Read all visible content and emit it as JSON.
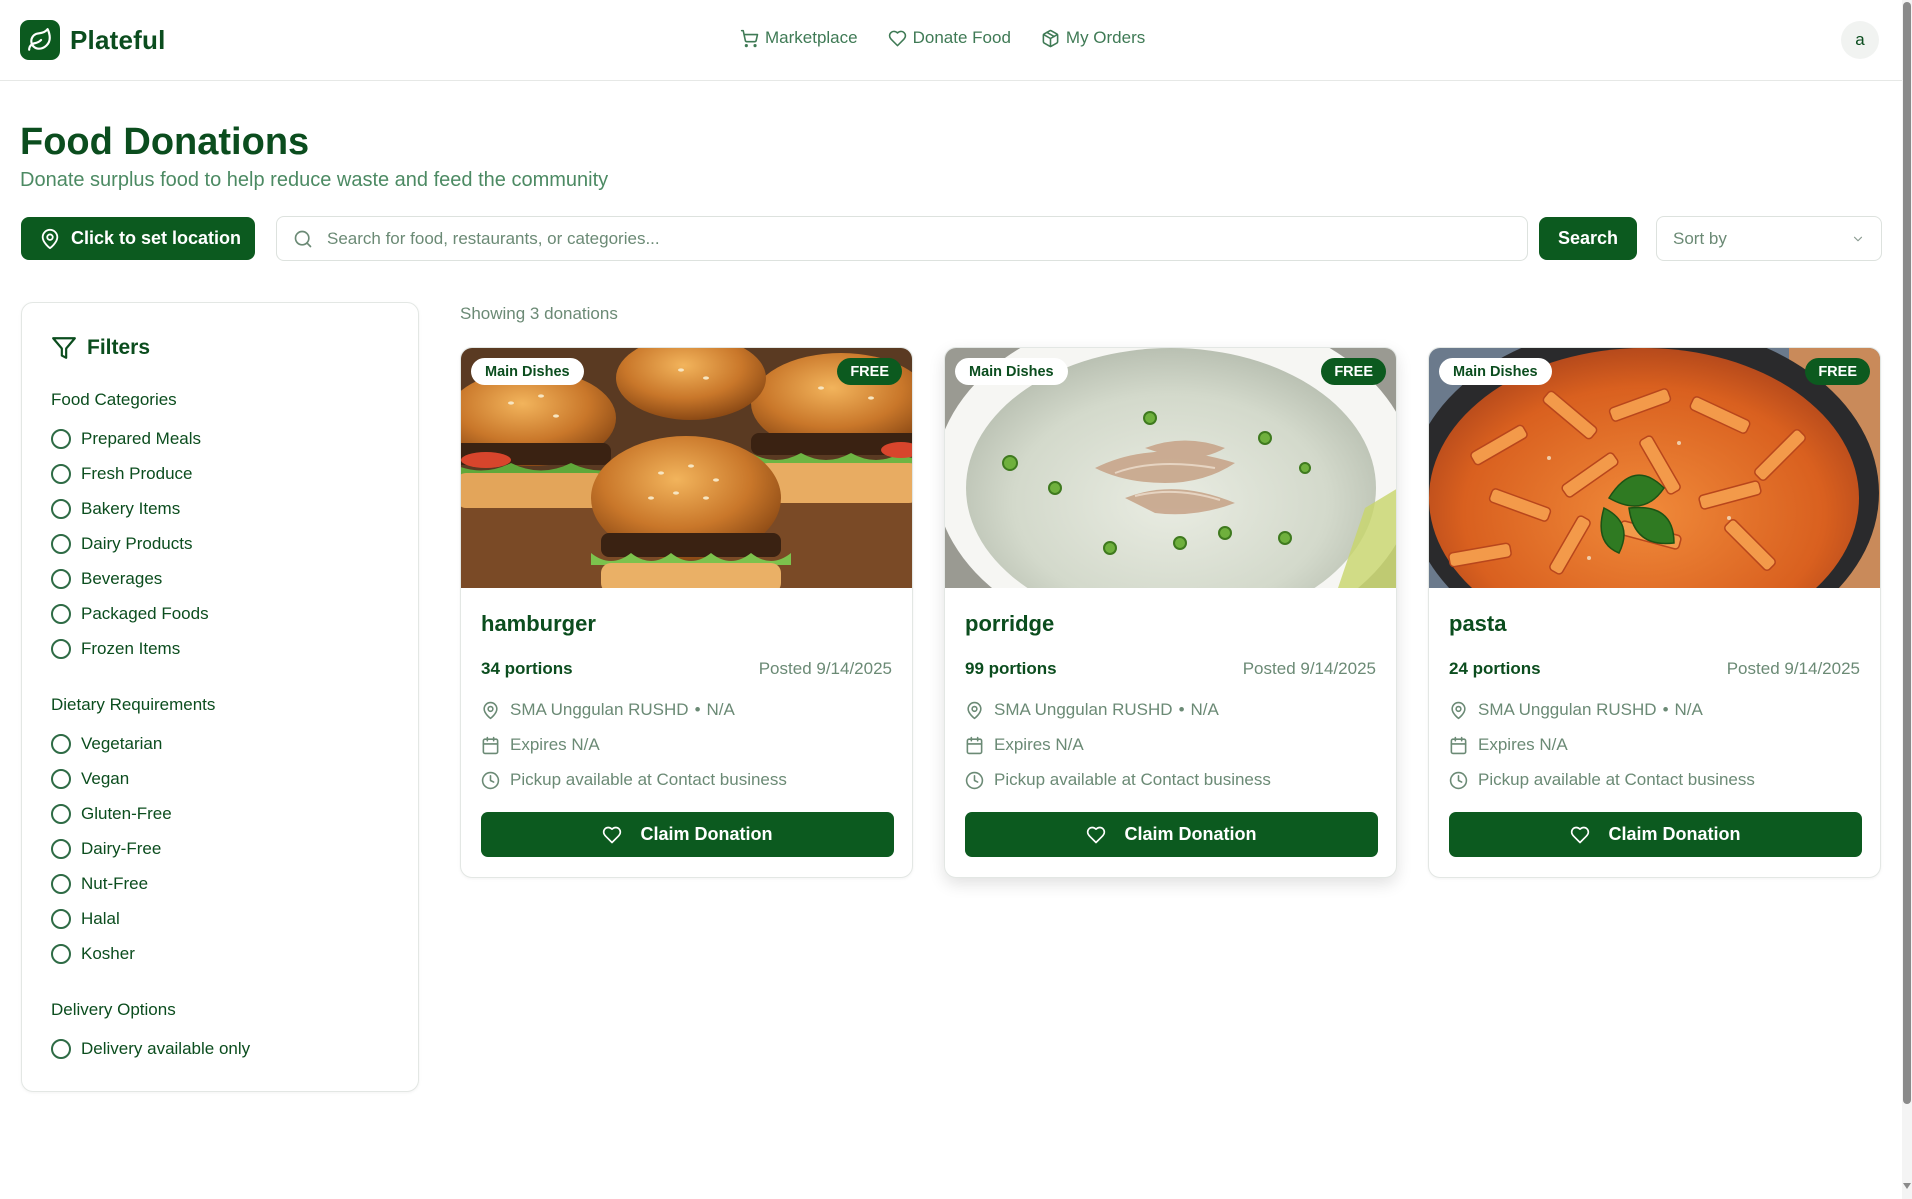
{
  "app": {
    "name": "Plateful",
    "avatar_initial": "a",
    "colors": {
      "primary": "#0c5a1f",
      "text": "#0b4d1e",
      "muted": "#6b8a75"
    }
  },
  "nav": {
    "items": [
      {
        "label": "Marketplace",
        "icon": "cart-icon"
      },
      {
        "label": "Donate Food",
        "icon": "heart-icon"
      },
      {
        "label": "My Orders",
        "icon": "package-icon"
      }
    ]
  },
  "hero": {
    "title": "Food Donations",
    "subtitle": "Donate surplus food to help reduce waste and feed the community"
  },
  "toolbar": {
    "location_label": "Click to set location",
    "search_placeholder": "Search for food, restaurants, or categories...",
    "search_value": "",
    "search_button": "Search",
    "sort_placeholder": "Sort by"
  },
  "filters": {
    "title": "Filters",
    "groups": [
      {
        "title": "Food Categories",
        "options": [
          "Prepared Meals",
          "Fresh Produce",
          "Bakery Items",
          "Dairy Products",
          "Beverages",
          "Packaged Foods",
          "Frozen Items"
        ]
      },
      {
        "title": "Dietary Requirements",
        "options": [
          "Vegetarian",
          "Vegan",
          "Gluten-Free",
          "Dairy-Free",
          "Nut-Free",
          "Halal",
          "Kosher"
        ]
      },
      {
        "title": "Delivery Options",
        "options": [
          "Delivery available only"
        ]
      }
    ]
  },
  "listing": {
    "count_text": "Showing 3 donations",
    "cards": [
      {
        "title": "hamburger",
        "category": "Main Dishes",
        "price_badge": "FREE",
        "portions": "34 portions",
        "posted": "Posted 9/14/2025",
        "location": "SMA Unggulan RUSHD",
        "location_extra": "N/A",
        "expires": "Expires N/A",
        "pickup": "Pickup available at Contact business",
        "claim_label": "Claim Donation",
        "image": "hamburger-photo"
      },
      {
        "title": "porridge",
        "category": "Main Dishes",
        "price_badge": "FREE",
        "portions": "99 portions",
        "posted": "Posted 9/14/2025",
        "location": "SMA Unggulan RUSHD",
        "location_extra": "N/A",
        "expires": "Expires N/A",
        "pickup": "Pickup available at Contact business",
        "claim_label": "Claim Donation",
        "image": "porridge-photo"
      },
      {
        "title": "pasta",
        "category": "Main Dishes",
        "price_badge": "FREE",
        "portions": "24 portions",
        "posted": "Posted 9/14/2025",
        "location": "SMA Unggulan RUSHD",
        "location_extra": "N/A",
        "expires": "Expires N/A",
        "pickup": "Pickup available at Contact business",
        "claim_label": "Claim Donation",
        "image": "pasta-photo"
      }
    ]
  }
}
